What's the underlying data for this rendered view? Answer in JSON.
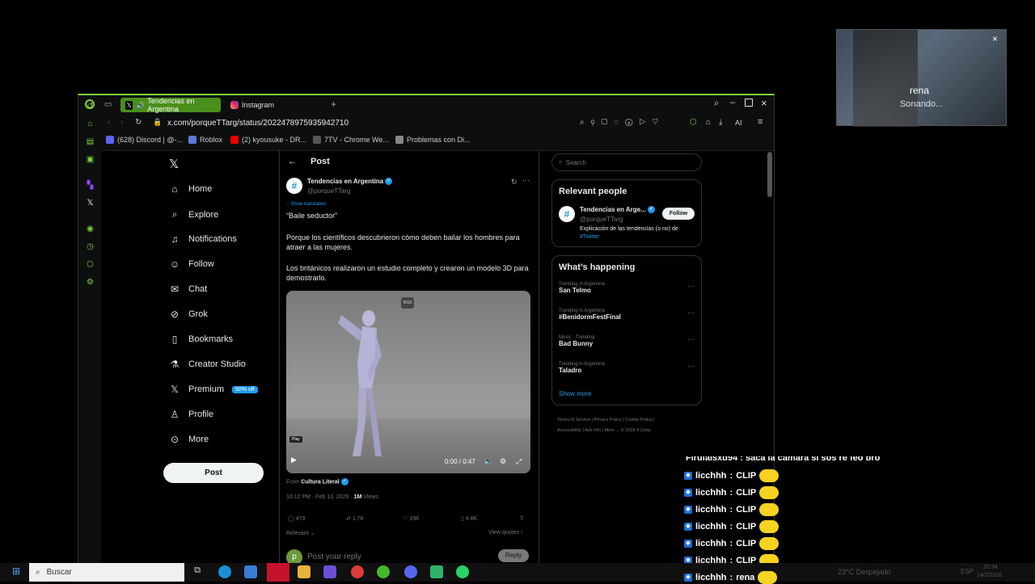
{
  "browser": {
    "tabs": [
      {
        "label": "Tendencias en Argentina",
        "active": true
      },
      {
        "label": "Instagram",
        "active": false
      }
    ],
    "url": "x.com/porqueTTarg/status/2022478975935942710",
    "ai_label": "AI",
    "bookmarks": [
      "(628) Discord | @-...",
      "Roblox",
      "(2) kyousuke - DR...",
      "7TV - Chrome We...",
      "Problemas con Di..."
    ]
  },
  "nav": {
    "items": [
      "Home",
      "Explore",
      "Notifications",
      "Follow",
      "Chat",
      "Grok",
      "Bookmarks",
      "Creator Studio",
      "Premium",
      "Profile",
      "More"
    ],
    "premium_badge": "50% off",
    "post_button": "Post"
  },
  "main": {
    "header": "Post",
    "author_name": "Tendencias en Argentina",
    "author_handle": "@porqueTTarg",
    "show_translation": "Show translation",
    "tweet_title": "“Baile seductor”",
    "tweet_body_1": "Porque los científicos descubrieron cómo deben bailar los hombres para atraer a las mujeres.",
    "tweet_body_2": "Los británicos realizaron un estudio completo y crearon un modelo 3D para demostrarlo.",
    "video_watermark": "RGX",
    "play_tooltip": "Play",
    "video_time": "0:00 / 0:47",
    "from_label": "From",
    "from_source": "Cultura Literal",
    "timestamp": "10:12 PM · Feb 13, 2026 ·",
    "views_count": "1M",
    "views_label": "Views",
    "stats": {
      "replies": "479",
      "reposts": "1.7K",
      "likes": "19K",
      "bookmarks": "4.8K"
    },
    "relevant_label": "Relevant",
    "view_quotes": "View quotes",
    "reply_placeholder": "Post your reply",
    "reply_button": "Reply",
    "reply_avatar_letter": "p"
  },
  "sidebar": {
    "search_placeholder": "Search",
    "relevant_people_title": "Relevant people",
    "person_name": "Tendencias en Arge...",
    "person_handle": "@porqueTTarg",
    "follow_button": "Follow",
    "person_bio": "Explicación de las tendencias (o no) de",
    "person_bio_tag": "#Twitter",
    "happening_title": "What’s happening",
    "trends": [
      {
        "context": "Trending in Argentina",
        "name": "San Telmo"
      },
      {
        "context": "Trending in Argentina",
        "name": "#BenidormFestFinal"
      },
      {
        "context": "Music · Trending",
        "name": "Bad Bunny"
      },
      {
        "context": "Trending in Argentina",
        "name": "Taladro"
      }
    ],
    "show_more": "Show more",
    "footer_links": [
      "Terms of Service",
      "Privacy Policy",
      "Cookie Policy",
      "Accessibility",
      "Ads info",
      "More ...",
      "© 2026 X Corp."
    ]
  },
  "camera": {
    "name": "rena",
    "status": "Sonando..."
  },
  "chat": {
    "partial_line": "Firulaisxd94 : saca la camara si sos re feo bro",
    "messages": [
      {
        "user": "licchhh",
        "text": "CLIP"
      },
      {
        "user": "licchhh",
        "text": "CLIP"
      },
      {
        "user": "licchhh",
        "text": "CLIP"
      },
      {
        "user": "licchhh",
        "text": "CLIP"
      },
      {
        "user": "licchhh",
        "text": "CLIP"
      },
      {
        "user": "licchhh",
        "text": "CLIP"
      },
      {
        "user": "licchhh",
        "text": "rena"
      }
    ]
  },
  "taskbar": {
    "search_label": "Buscar",
    "weather": "23°C  Despejado",
    "language": "ESP",
    "time": "20:34",
    "date": "14/2/2026"
  },
  "colors": {
    "accent_green": "#7bd33a",
    "x_blue": "#1d9bf0"
  }
}
